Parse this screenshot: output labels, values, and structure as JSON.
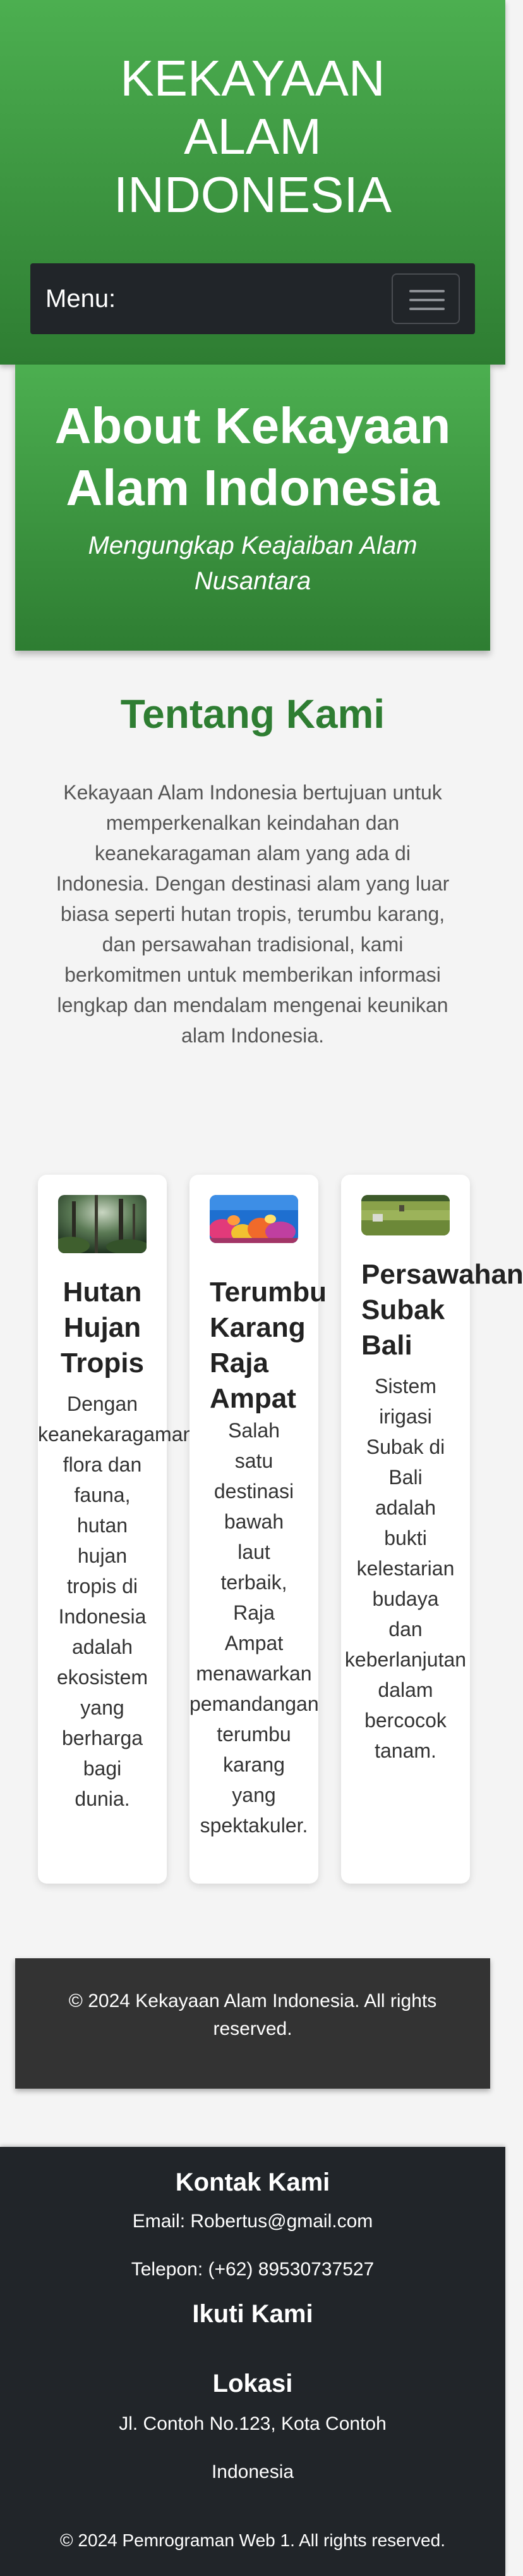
{
  "header": {
    "title": "KEKAYAAN\nALAM\nINDONESIA"
  },
  "navbar": {
    "menu_label": "Menu:"
  },
  "about": {
    "title": "About Kekayaan Alam Indonesia",
    "subtitle": "Mengungkap Keajaiban Alam Nusantara"
  },
  "tentang": {
    "title": "Tentang Kami",
    "text": "Kekayaan Alam Indonesia bertujuan untuk memperkenalkan keindahan dan keanekaragaman alam yang ada di Indonesia. Dengan destinasi alam yang luar biasa seperti hutan tropis, terumbu karang, dan persawahan tradisional, kami berkomitmen untuk memberikan informasi lengkap dan mendalam mengenai keunikan alam Indonesia."
  },
  "cards": [
    {
      "title": "Hutan\nHujan\nTropis",
      "text": "Dengan\nkeanekaragaman\nflora dan\nfauna,\nhutan\nhujan\ntropis di\nIndonesia\nadalah\nekosistem\nyang\nberharga\nbagi\ndunia."
    },
    {
      "title": "Terumbu\nKarang\nRaja\nAmpat",
      "text": "Salah\nsatu\ndestinasi\nbawah\nlaut\nterbaik,\nRaja\nAmpat\nmenawarkan\npemandangan\nterumbu\nkarang\nyang\nspektakuler."
    },
    {
      "title": "Persawahan\nSubak\nBali",
      "text": "Sistem\nirigasi\nSubak di\nBali\nadalah\nbukti\nkelestarian\nbudaya\ndan\nkeberlanjutan\ndalam\nbercocok\ntanam."
    }
  ],
  "copyright_box": {
    "text": "© 2024 Kekayaan Alam Indonesia. All rights reserved."
  },
  "footer": {
    "contact_heading": "Kontak Kami",
    "email": "Email: Robertus@gmail.com",
    "phone": "Telepon: (+62) 89530737527",
    "follow_heading": "Ikuti Kami",
    "location_heading": "Lokasi",
    "address_line1": "Jl. Contoh No.123, Kota Contoh",
    "address_line2": "Indonesia",
    "copyright": "© 2024 Pemrograman Web 1. All rights reserved."
  },
  "colors": {
    "green_light": "#4caf50",
    "green_dark": "#2e7d32",
    "dark": "#212529",
    "footer_box": "#333333"
  }
}
